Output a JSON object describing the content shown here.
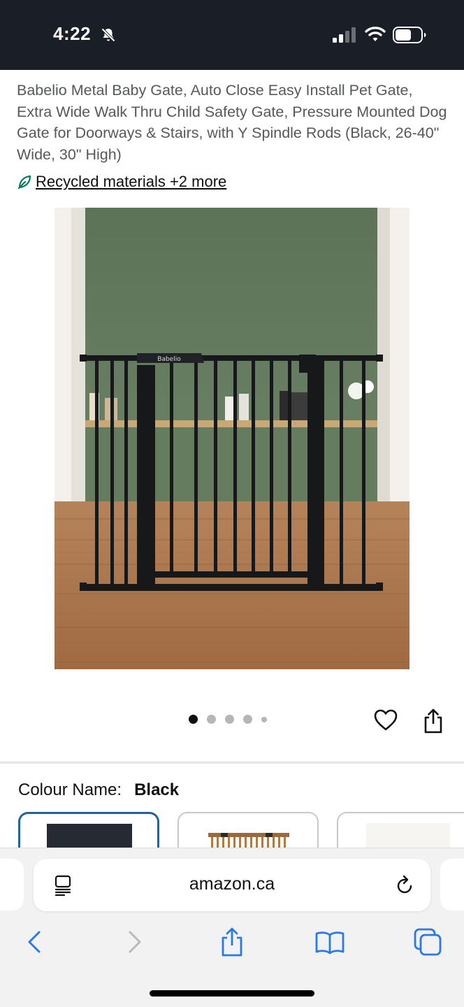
{
  "status_bar": {
    "time": "4:22",
    "battery_level": 0.5
  },
  "product": {
    "title": "Babelio Metal Baby Gate, Auto Close Easy Install Pet Gate, Extra Wide Walk Thru Child Safety Gate, Pressure Mounted Dog Gate for Doorways & Stairs, with Y Spindle Rods (Black, 26-40\" Wide, 30\" High)",
    "recycled_link": "Recycled materials +2 more",
    "image_logo_text": "Babelio",
    "image_count": 5,
    "active_image": 1
  },
  "colour": {
    "label": "Colour Name:",
    "value": "Black"
  },
  "swatches": [
    {
      "name": "Black",
      "selected": true
    },
    {
      "name": "Wood",
      "selected": false
    },
    {
      "name": "White",
      "selected": false
    }
  ],
  "browser": {
    "url": "amazon.ca"
  },
  "icons": {
    "bell": "bell-slash-icon",
    "heart": "heart-icon",
    "share": "share-icon",
    "reader": "reader-icon",
    "reload": "reload-icon",
    "back": "chevron-left-icon",
    "forward": "chevron-right-icon",
    "bookmarks": "book-icon",
    "tabs": "tabs-icon"
  },
  "colors": {
    "accent": "#2162a1",
    "status_bar": "#1a1f27",
    "leaf": "#067d62"
  }
}
